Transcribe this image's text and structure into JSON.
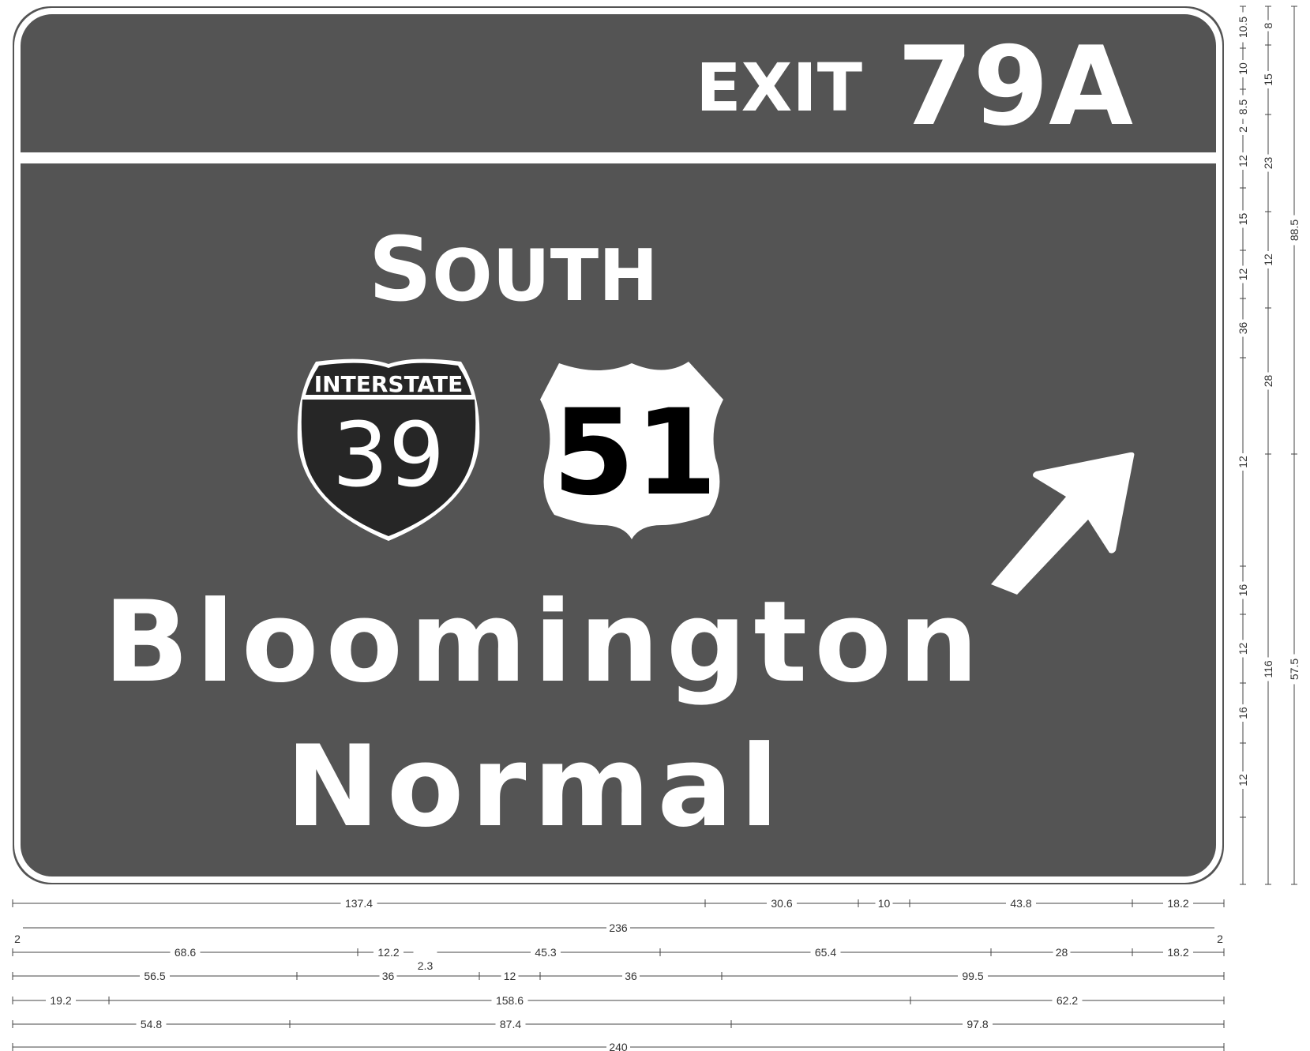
{
  "colors": {
    "sign_background": "#545454",
    "legend": "#ffffff",
    "interstate_shield": "#262626",
    "dimension_lines": "#444444"
  },
  "exit_panel": {
    "label": "EXIT",
    "number": "79A"
  },
  "direction": {
    "first_letter": "S",
    "rest": "OUTH"
  },
  "shields": {
    "interstate": {
      "banner": "INTERSTATE",
      "number": "39"
    },
    "us_route": {
      "number": "51"
    }
  },
  "destinations": [
    "Bloomington",
    "Normal"
  ],
  "arrow": {
    "icon": "arrow-up-right-icon"
  },
  "dimensions": {
    "horizontal": [
      [
        "137.4",
        "30.6",
        "10",
        "43.8",
        "18.2"
      ],
      [
        "2",
        "236",
        "2"
      ],
      [
        "68.6",
        "12.2",
        "2.3",
        "45.3",
        "65.4",
        "28",
        "18.2"
      ],
      [
        "56.5",
        "36",
        "12",
        "36",
        "99.5"
      ],
      [
        "19.2",
        "158.6",
        "62.2"
      ],
      [
        "54.8",
        "87.4",
        "97.8"
      ],
      [
        "240"
      ]
    ],
    "vertical_inner": [
      "10.5",
      "10",
      "8.5",
      "2",
      "12",
      "15",
      "12",
      "36",
      "12",
      "16",
      "12",
      "16",
      "12"
    ],
    "vertical_middle": [
      "8",
      "15",
      "23",
      "12",
      "28",
      "116"
    ],
    "vertical_outer": [
      "88.5",
      "57.5"
    ]
  }
}
